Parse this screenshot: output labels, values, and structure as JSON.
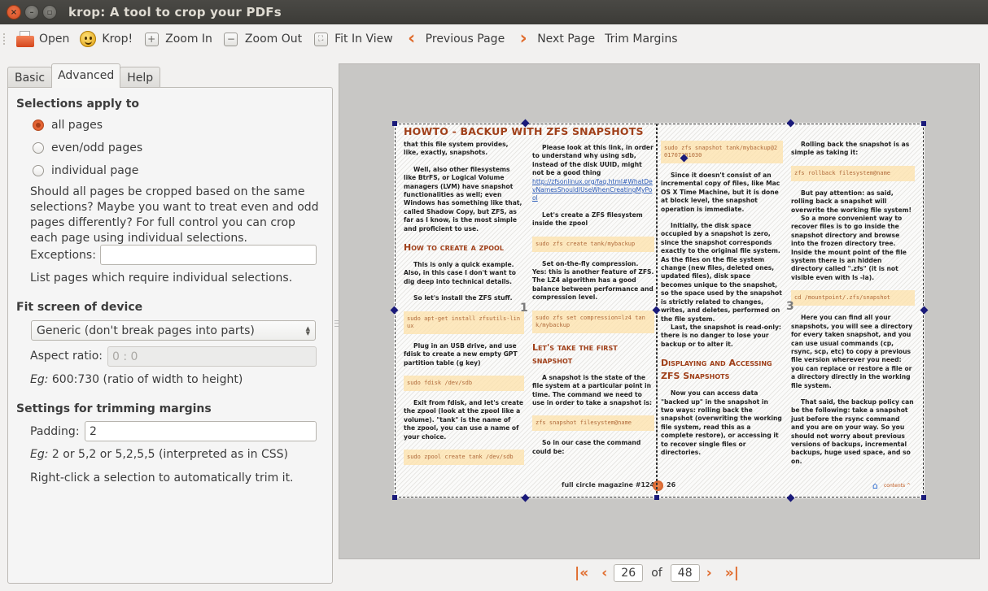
{
  "window": {
    "title": "krop: A tool to crop your PDFs",
    "controls": [
      "close",
      "minimize",
      "maximize"
    ]
  },
  "toolbar": {
    "items": [
      {
        "label": "Open",
        "icon": "folder-open-icon"
      },
      {
        "label": "Krop!",
        "icon": "smiley-icon"
      },
      {
        "label": "Zoom In",
        "icon": "zoom-in-icon"
      },
      {
        "label": "Zoom Out",
        "icon": "zoom-out-icon"
      },
      {
        "label": "Fit In View",
        "icon": "fit-view-icon"
      },
      {
        "label": "Previous Page",
        "icon": "chevron-left-icon"
      },
      {
        "label": "Next Page",
        "icon": "chevron-right-icon"
      },
      {
        "label": "Trim Margins",
        "icon": ""
      }
    ]
  },
  "tabs": [
    {
      "label": "Basic",
      "active": false
    },
    {
      "label": "Advanced",
      "active": true
    },
    {
      "label": "Help",
      "active": false
    }
  ],
  "advanced": {
    "selections": {
      "title": "Selections apply to",
      "options": [
        {
          "label": "all pages",
          "checked": true
        },
        {
          "label": "even/odd pages",
          "checked": false
        },
        {
          "label": "individual page",
          "checked": false
        }
      ],
      "description": "Should all pages be cropped based on the same selections? Maybe you want to treat even and odd pages differently? For full control you can crop each page using individual selections.",
      "exceptions_label": "Exceptions:",
      "exceptions_value": "",
      "exceptions_hint": "List pages which require individual selections."
    },
    "fit_screen": {
      "title": "Fit screen of device",
      "device_selected": "Generic (don't break pages into parts)",
      "aspect_label": "Aspect ratio:",
      "aspect_value": "0 : 0",
      "hint_prefix": "Eg:",
      "hint_text": " 600:730 (ratio of width to height)"
    },
    "trimming": {
      "title": "Settings for trimming margins",
      "padding_label": "Padding:",
      "padding_value": "2",
      "hint_prefix": "Eg:",
      "hint_text": " 2 or 5,2 or 5,2,5,5 (interpreted as in CSS)",
      "right_click_hint": "Right-click a selection to automatically trim it."
    }
  },
  "pdf": {
    "heading": "HOWTO - BACKUP WITH ZFS SNAPSHOTS",
    "selection_labels": [
      "1",
      "3"
    ],
    "footer_left": "full circle magazine #124",
    "footer_page": "26",
    "footer_contents": "contents ^",
    "col1": {
      "p1": "that this file system provides, like, exactly, snapshots.",
      "p2": "Well, also other filesystems like BtrFS, or Logical Volume managers (LVM) have snapshot functionalities as well; even Windows has something like that, called Shadow Copy, but ZFS, as far as I know, is the most simple and proficient to use.",
      "h_zpool": "How to create a zpool",
      "p3": "This is only a quick example. Also, in this case I don't want to dig deep into technical details.",
      "p4": "So let's install the ZFS stuff.",
      "code1": "sudo apt-get install zfsutils-linux",
      "p5": "Plug in an USB drive, and use fdisk to create a new empty GPT partition table (g key)",
      "code2": "sudo fdisk /dev/sdb",
      "p6": "Exit from fdisk, and let's create the zpool (look at the zpool like a volume). \"tank\" is the name of the zpool, you can use a name of your choice.",
      "code3": "sudo zpool create tank /dev/sdb"
    },
    "col2": {
      "p1": "Please look at this link, in order to understand why using sdb, instead of the disk UUID, might not be a good thing",
      "link": "http://zfsonlinux.org/faq.html#WhatDevNamesShouldIUseWhenCreatingMyPool",
      "p2": "Let's create a ZFS filesystem inside the zpool",
      "code1": "sudo zfs create tank/mybackup",
      "p3": "Set on-the-fly compression. Yes: this is another feature of ZFS. The LZ4 algorithm has a good balance between performance and compression level.",
      "code2": "sudo zfs set compression=lz4 tank/mybackup",
      "h_snapshot": "Let's take the first snapshot",
      "p4": "A snapshot is the state of the file system at a particular point in time. The command we need to use in order to take a snapshot is:",
      "code3": "zfs snapshot filesystem@name",
      "p5": "So in our case the command could be:"
    },
    "col3": {
      "code1": "sudo zfs snapshot tank/mybackup@201707281030",
      "p1": "Since it doesn't consist of an incremental copy of files, like Mac OS X Time Machine, but it is done at block level, the snapshot operation is immediate.",
      "p2": "Initially, the disk space occupied by a snapshot is zero, since the snapshot corresponds exactly to the original file system. As the files on the file system change (new files, deleted ones, updated files), disk space becomes unique to the snapshot, so the space used by the snapshot is strictly related to changes, writes, and deletes, performed on the file system.",
      "p3": "Last, the snapshot is read-only: there is no danger to lose your backup or to alter it.",
      "h_display": "Displaying and Accessing ZFS Snapshots",
      "p4": "Now you can access data \"backed up\" in the snapshot in two ways: rolling back the snapshot (overwriting the working file system, read this as a complete restore), or accessing it to recover single files or directories."
    },
    "col4": {
      "p1": "Rolling back the snapshot is as simple as taking it:",
      "code1": "zfs rollback filesystem@name",
      "p2": "But pay attention: as said, rolling back a snapshot will overwrite the working file system!",
      "p3": "So a more convenient way to recover files is to go inside the snapshot directory and browse into the frozen directory tree. Inside the mount point of the file system there is an hidden directory called \".zfs\" (it is not visible even with ls -la).",
      "code2": "cd /mountpoint/.zfs/snapshot",
      "p4": "Here you can find all your snapshots, you will see a directory for every taken snapshot, and you can use usual commands (cp, rsync, scp, etc) to copy a previous file version wherever you need: you can replace or restore a file or a directory directly in the working file system.",
      "p5": "That said, the backup policy can be the following: take a snapshot just before the rsync command and you are on your way. So you should not worry about previous versions of backups, incremental backups, huge used space, and so on."
    }
  },
  "pager": {
    "current_page": "26",
    "of_label": "of",
    "total_pages": "48"
  }
}
